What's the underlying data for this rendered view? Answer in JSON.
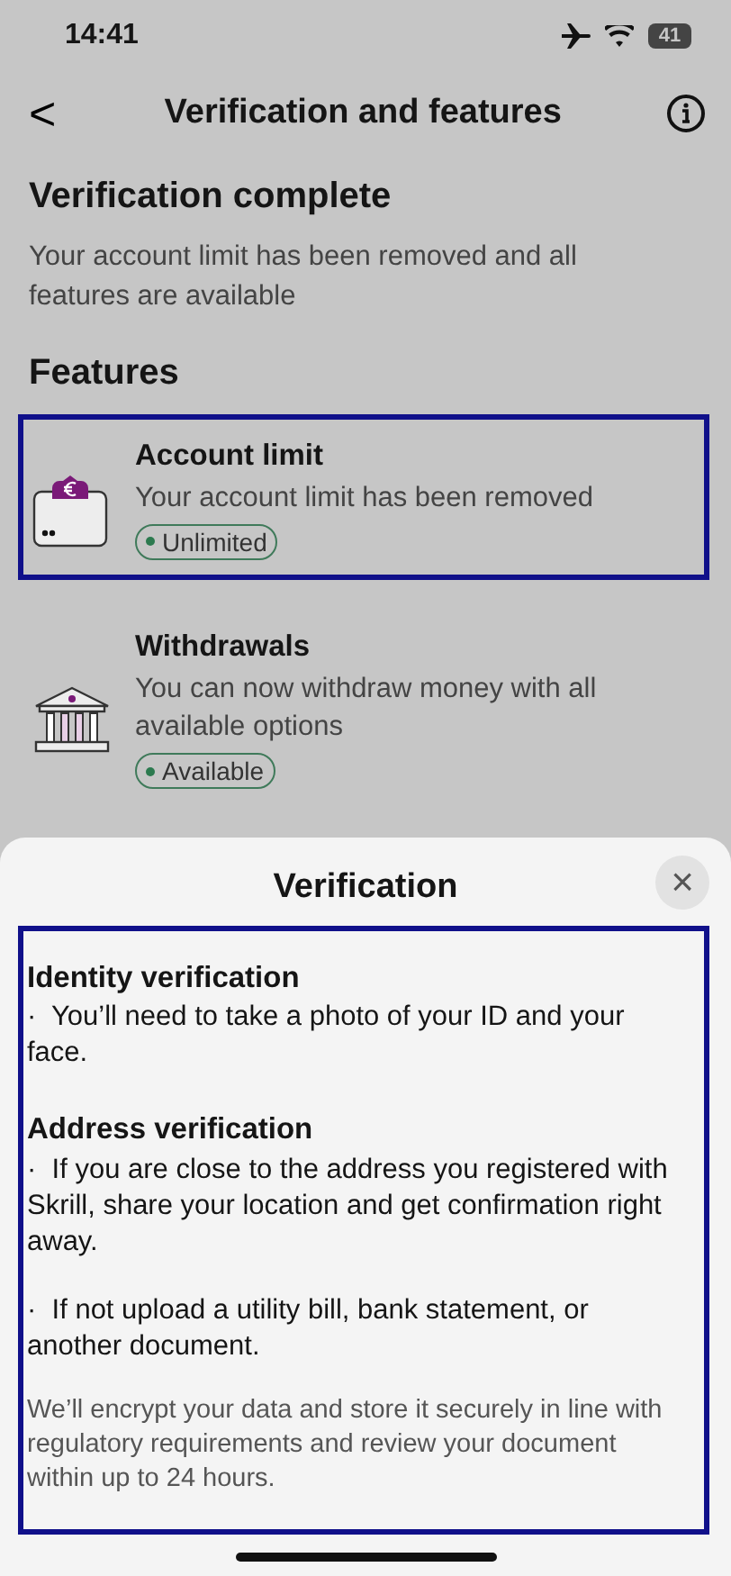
{
  "status_bar": {
    "time": "14:41",
    "battery": "41"
  },
  "header": {
    "back": "<",
    "title": "Verification and features"
  },
  "summary": {
    "title": "Verification complete",
    "text": "Your account limit has been removed and all features are available"
  },
  "features": {
    "title": "Features",
    "items": [
      {
        "kind": "wallet",
        "title": "Account limit",
        "text": "Your account limit has been removed",
        "status": "Unlimited",
        "highlighted": true
      },
      {
        "kind": "bank",
        "title": "Withdrawals",
        "text": "You can now withdraw money with all available options",
        "status": "Available",
        "highlighted": false
      }
    ]
  },
  "sheet": {
    "title": "Verification",
    "close": "×",
    "highlighted": true,
    "sections": [
      {
        "heading": "Identity verification",
        "bullets": [
          "·  You’ll need to take a photo of your ID and your face."
        ]
      },
      {
        "heading": "Address verification",
        "bullets": [
          "·  If you are close to the address you registered with Skrill, share your location and get confirmation right away.",
          "·  If not upload a utility bill, bank statement, or another document."
        ]
      }
    ],
    "note": "We’ll encrypt your data and store it securely in line with regulatory requirements and review your document within up to 24 hours."
  }
}
